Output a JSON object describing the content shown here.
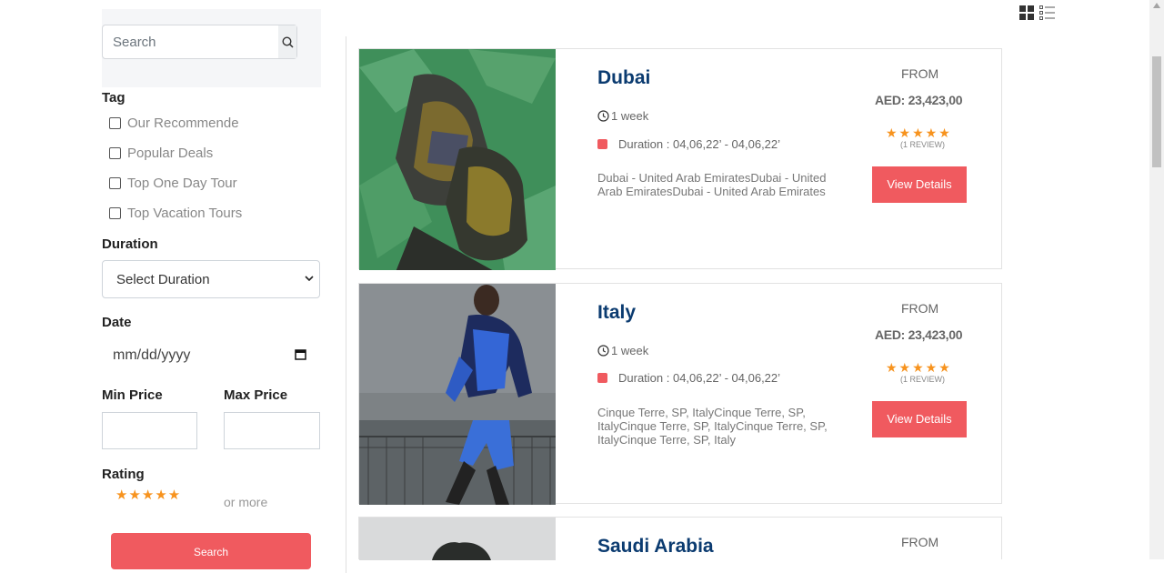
{
  "sidebar": {
    "search_placeholder": "Search",
    "tag_label": "Tag",
    "tags": [
      "Our Recommende",
      "Popular Deals",
      "Top One Day Tour",
      "Top Vacation Tours"
    ],
    "duration_label": "Duration",
    "duration_selected": "Select Duration",
    "date_label": "Date",
    "date_placeholder": "mm/dd/yyyy",
    "min_price_label": "Min Price",
    "max_price_label": "Max Price",
    "rating_label": "Rating",
    "rating_stars": "★★★★★",
    "rating_suffix": "or more",
    "search_button": "Search"
  },
  "results": [
    {
      "title": "Dubai",
      "duration": "1 week",
      "dates": "Duration : 04,06,22’ - 04,06,22’",
      "location": "Dubai - United Arab EmiratesDubai - United Arab EmiratesDubai - United Arab Emirates",
      "from_label": "FROM",
      "price": "AED: 23,423,00",
      "stars": "★★★★★",
      "reviews": "(1 REVIEW)",
      "button": "View Details"
    },
    {
      "title": "Italy",
      "duration": "1 week",
      "dates": "Duration : 04,06,22’ - 04,06,22’",
      "location": "Cinque Terre, SP, ItalyCinque Terre, SP, ItalyCinque Terre, SP, ItalyCinque Terre, SP, ItalyCinque Terre, SP, Italy",
      "from_label": "FROM",
      "price": "AED: 23,423,00",
      "stars": "★★★★★",
      "reviews": "(1 REVIEW)",
      "button": "View Details"
    },
    {
      "title": "Saudi Arabia",
      "from_label": "FROM"
    }
  ],
  "colors": {
    "accent": "#f05a5f",
    "title": "#0b3b70",
    "star": "#f7931e"
  }
}
